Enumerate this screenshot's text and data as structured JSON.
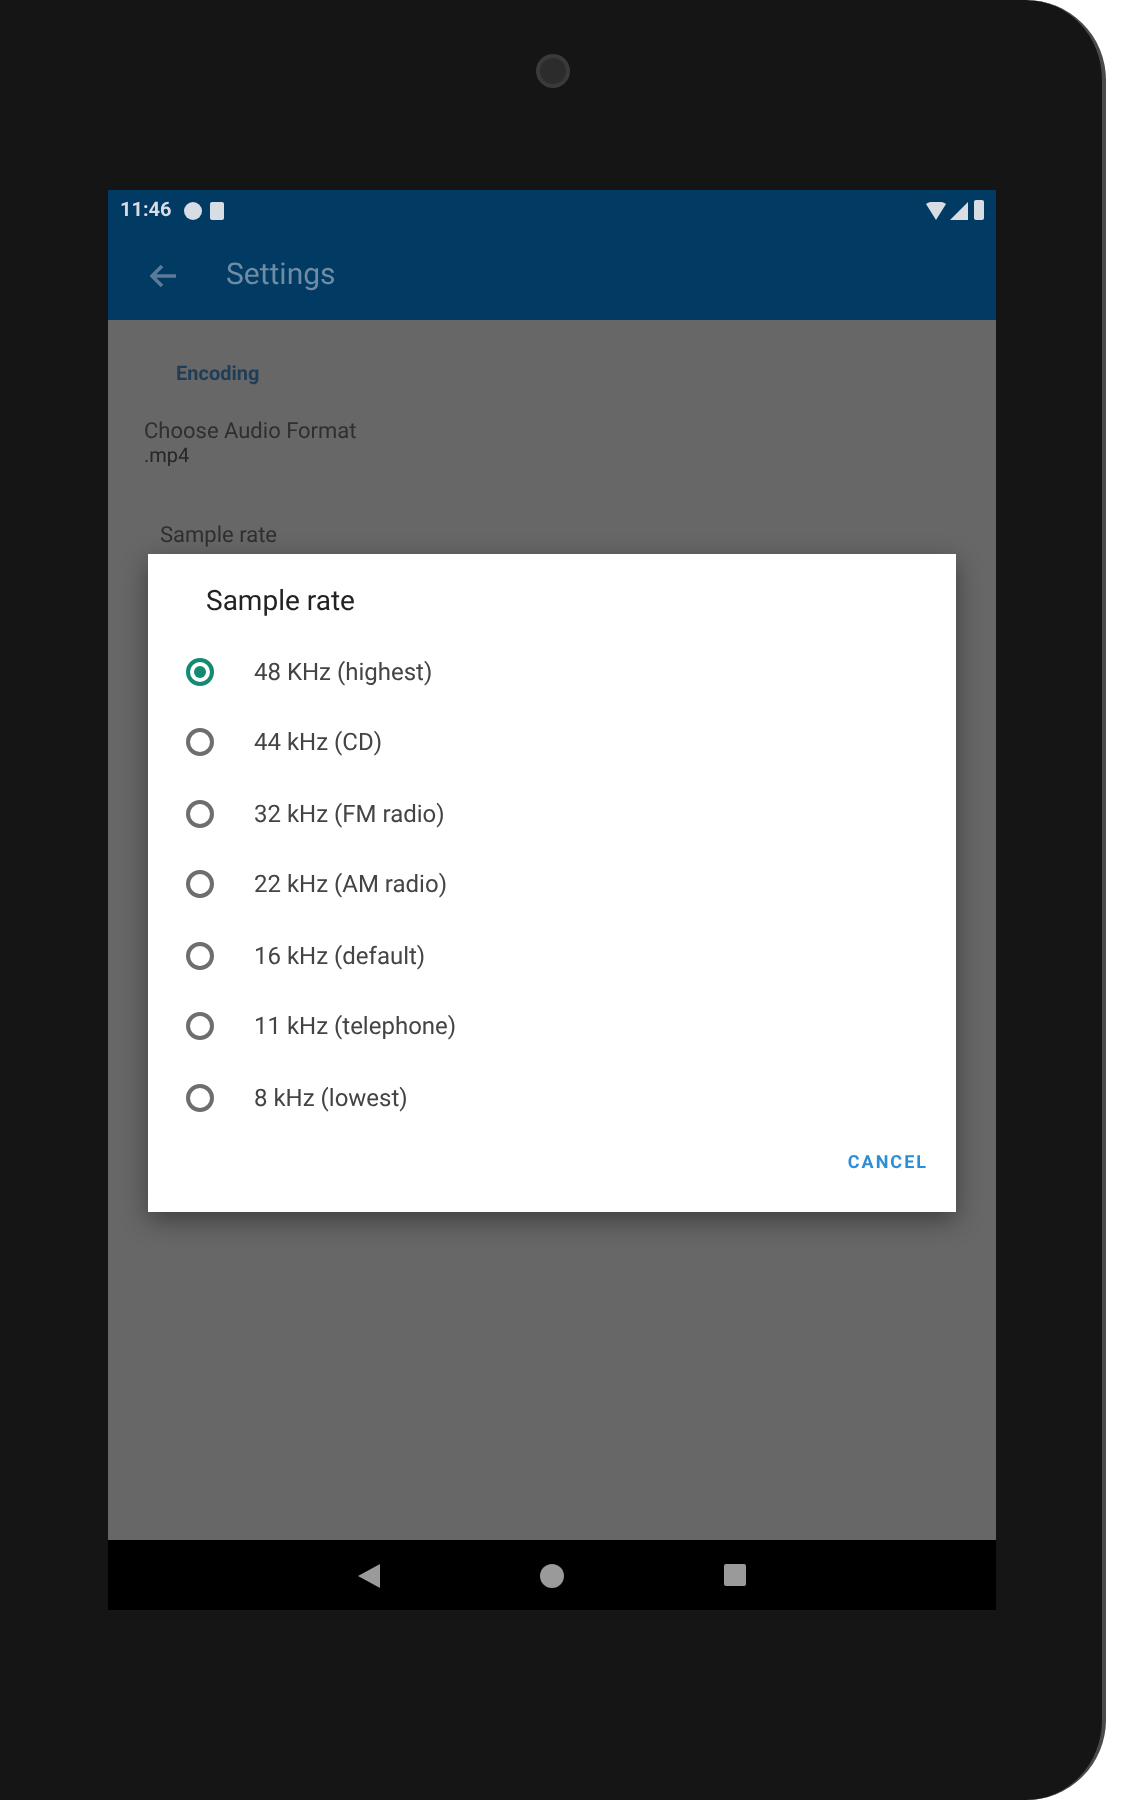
{
  "status_bar": {
    "time": "11:46"
  },
  "app_bar": {
    "title": "Settings"
  },
  "settings": {
    "section": "Encoding",
    "items": [
      {
        "title": "Choose Audio Format",
        "summary": ".mp4"
      },
      {
        "title": "Sample rate"
      }
    ]
  },
  "dialog": {
    "title": "Sample rate",
    "options": [
      {
        "label": "48 KHz (highest)",
        "selected": true
      },
      {
        "label": "44 kHz (CD)",
        "selected": false
      },
      {
        "label": "32 kHz (FM radio)",
        "selected": false
      },
      {
        "label": "22 kHz (AM radio)",
        "selected": false
      },
      {
        "label": "16 kHz (default)",
        "selected": false
      },
      {
        "label": "11 kHz (telephone)",
        "selected": false
      },
      {
        "label": "8 kHz (lowest)",
        "selected": false
      }
    ],
    "buttons": [
      "CANCEL"
    ]
  }
}
